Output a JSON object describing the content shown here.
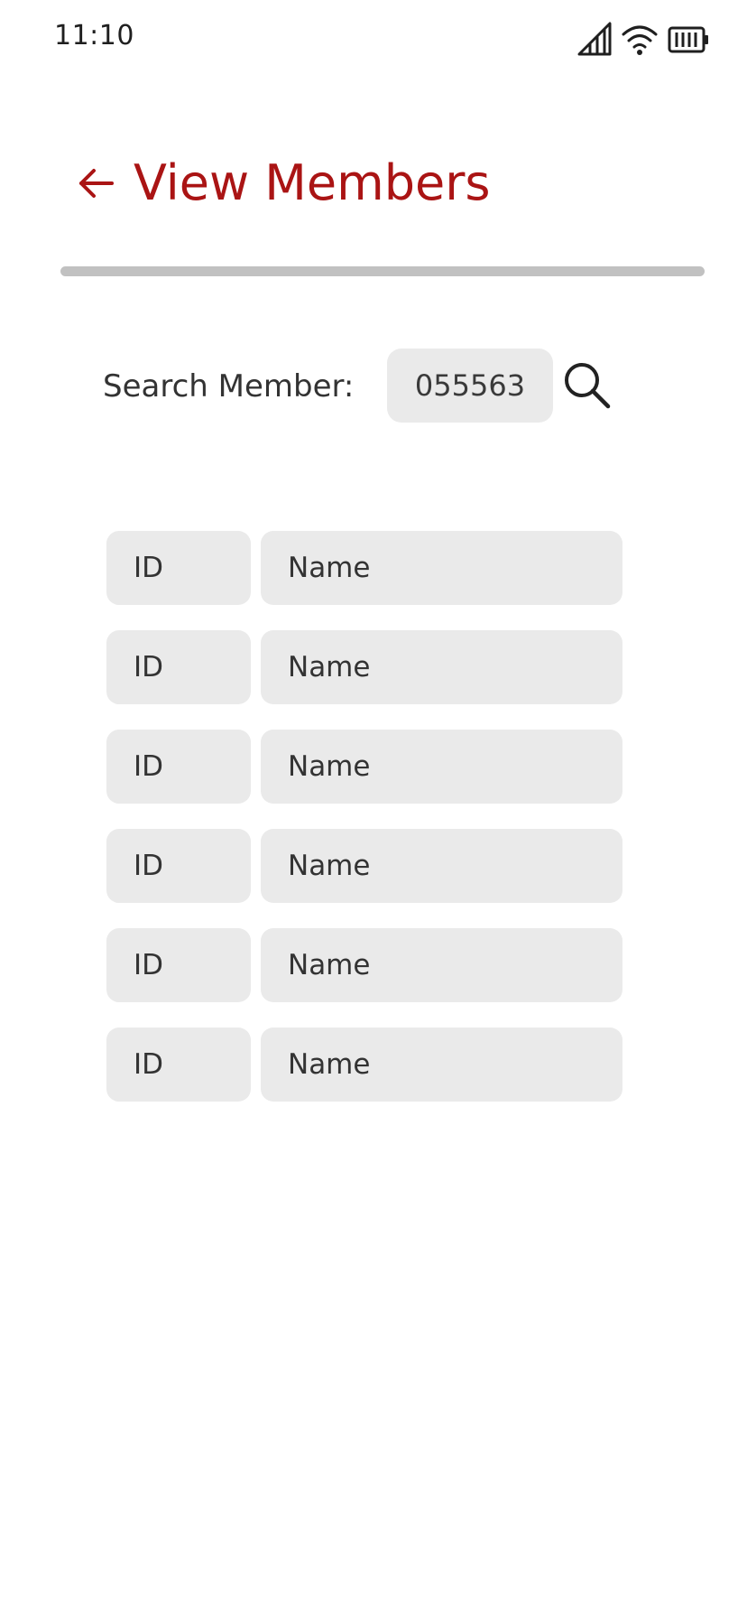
{
  "status_bar": {
    "time": "11:10",
    "icons": [
      "cellular-signal-icon",
      "wifi-icon",
      "battery-icon"
    ]
  },
  "header": {
    "back_icon": "arrow-left-icon",
    "title": "View Members"
  },
  "search": {
    "label": "Search Member:",
    "value": "055563",
    "icon": "search-icon"
  },
  "members": [
    {
      "id": "ID",
      "name": "Name"
    },
    {
      "id": "ID",
      "name": "Name"
    },
    {
      "id": "ID",
      "name": "Name"
    },
    {
      "id": "ID",
      "name": "Name"
    },
    {
      "id": "ID",
      "name": "Name"
    },
    {
      "id": "ID",
      "name": "Name"
    }
  ],
  "colors": {
    "accent": "#aa1414",
    "field_background": "#eaeaea",
    "divider": "#c1c1c1"
  }
}
